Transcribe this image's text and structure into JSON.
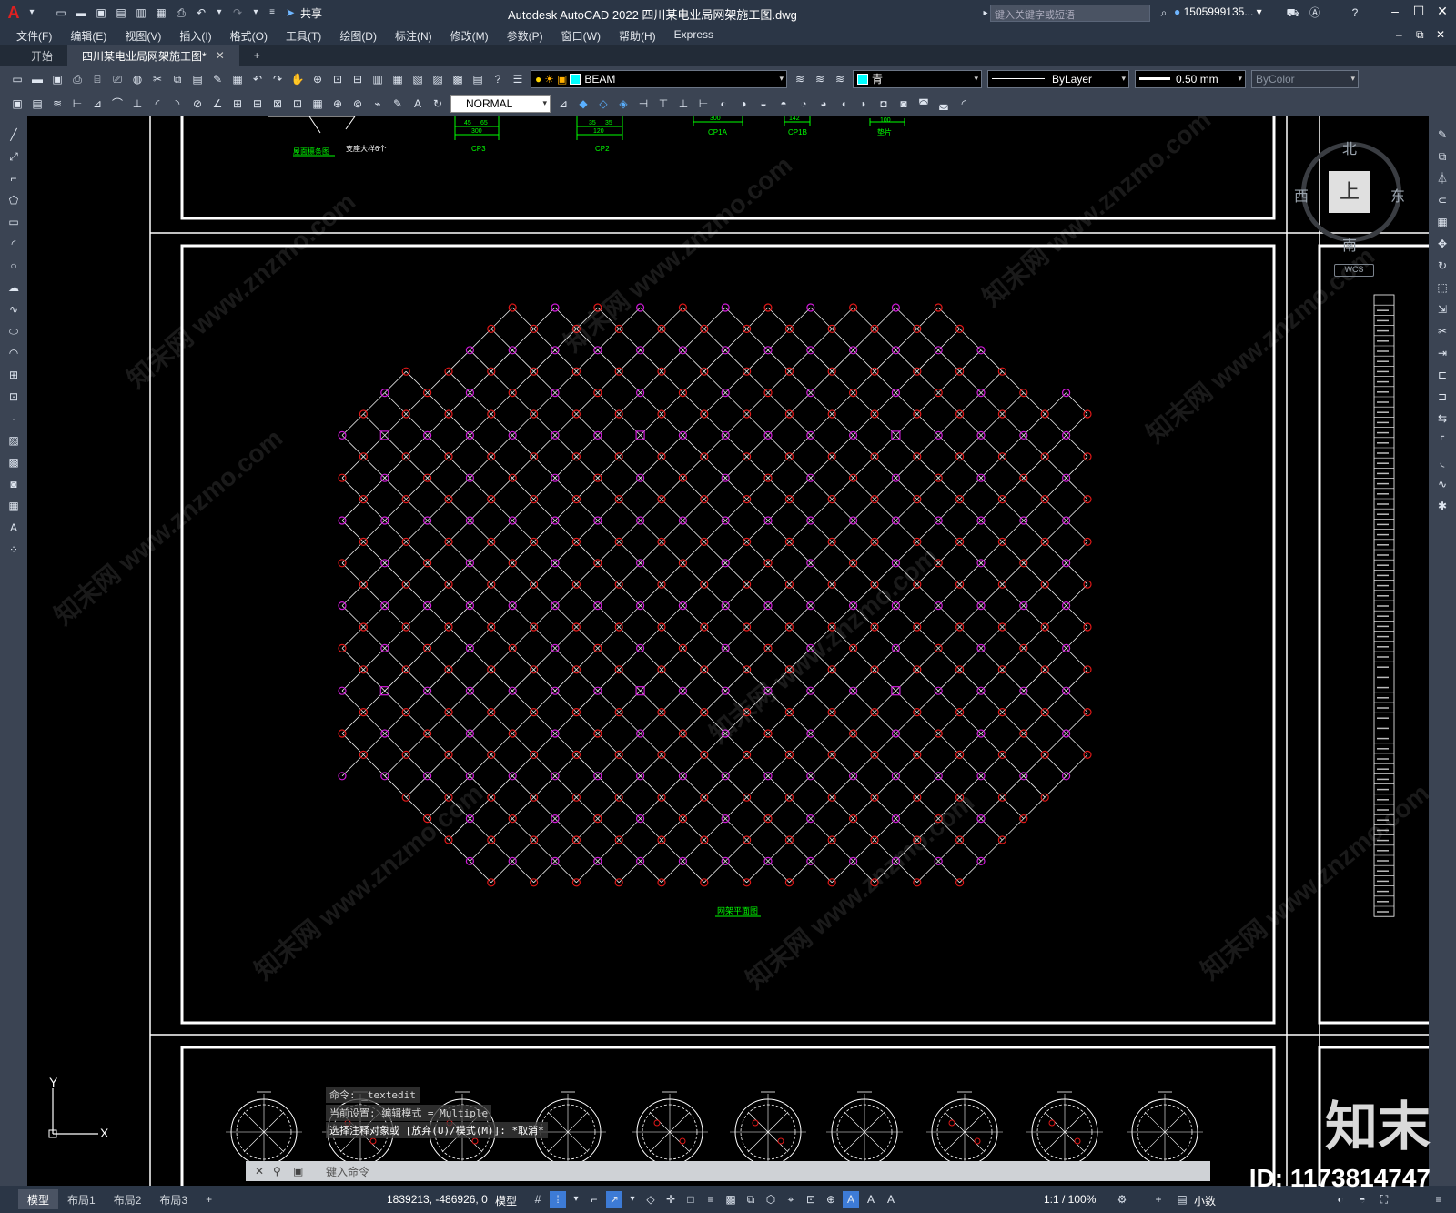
{
  "app": {
    "title": "Autodesk AutoCAD 2022    四川某电业局网架施工图.dwg",
    "share_label": "共享",
    "search_placeholder": "键入关键字或短语",
    "user": "1505999135...",
    "logo": "A"
  },
  "menu": [
    "文件(F)",
    "编辑(E)",
    "视图(V)",
    "插入(I)",
    "格式(O)",
    "工具(T)",
    "绘图(D)",
    "标注(N)",
    "修改(M)",
    "参数(P)",
    "窗口(W)",
    "帮助(H)",
    "Express"
  ],
  "tabs": {
    "start": "开始",
    "document": "四川某电业局网架施工图*",
    "close": "✕",
    "add": "+"
  },
  "toolbar1": {
    "layer": "BEAM",
    "color": "青",
    "linetype": "ByLayer",
    "lineweight": "0.50 mm",
    "plotstyle": "ByColor"
  },
  "toolbar2": {
    "style": "NORMAL"
  },
  "viewcube": {
    "north": "北",
    "south": "南",
    "east": "东",
    "west": "西",
    "face": "上",
    "wcs": "WCS"
  },
  "drawing": {
    "top_labels": [
      "屋面檩条图",
      "支座大样6个",
      "CP3",
      "CP2",
      "CP1A",
      "CP1B",
      "垫片"
    ],
    "top_dims": [
      "45",
      "65",
      "300",
      "35",
      "35",
      "120",
      "300",
      "142",
      "100"
    ],
    "plan_caption": "网架平面图",
    "ucs_x": "X",
    "ucs_y": "Y"
  },
  "command": {
    "line1": "命令:  _textedit",
    "line2": "当前设置: 编辑模式 = Multiple",
    "line3": "选择注释对象或 [放弃(U)/模式(M)]: *取消*",
    "prompt": "键入命令"
  },
  "status": {
    "layouts": [
      "模型",
      "布局1",
      "布局2",
      "布局3",
      "+"
    ],
    "coords": "1839213, -486926, 0",
    "mode": "模型",
    "scale": "1:1 / 100%",
    "units": "小数"
  },
  "watermark": {
    "brand": "知末",
    "id": "ID: 1173814747",
    "site": "知末网 www.znzmo.com"
  },
  "colors": {
    "node_red": "#e01818",
    "node_magenta": "#d01ad8",
    "member_white": "#f0f0f0",
    "label_green": "#00ff00",
    "frame_white": "#ffffff",
    "cyan": "#00ffff"
  }
}
